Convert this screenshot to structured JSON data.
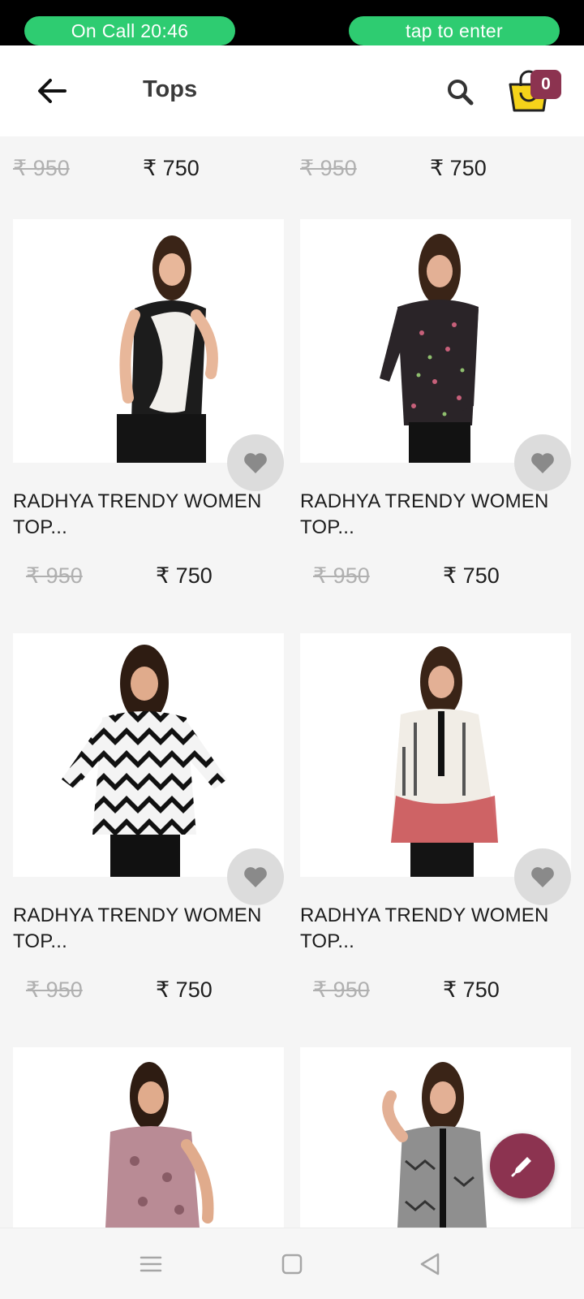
{
  "call_bar": {
    "status_text": "On Call   20:46",
    "action_text": "tap to enter",
    "pill_color": "#2ecc71"
  },
  "app_bar": {
    "title": "Tops",
    "back_icon": "arrow-left-icon",
    "search_icon": "search-icon",
    "cart_icon": "shopping-bag-icon",
    "cart_count": "0",
    "accent_color": "#8c3350",
    "cart_color": "#f5d31a"
  },
  "top_partial_row": [
    {
      "old_price": "₹ 950",
      "price": "₹ 750"
    },
    {
      "old_price": "₹ 950",
      "price": "₹ 750"
    }
  ],
  "products": [
    {
      "name": "RADHYA TRENDY WOMEN TOP...",
      "old_price": "₹ 950",
      "price": "₹ 750",
      "image": "woman-black-white-sleeveless-top"
    },
    {
      "name": "RADHYA TRENDY WOMEN TOP...",
      "old_price": "₹ 950",
      "price": "₹ 750",
      "image": "woman-dark-floral-top"
    },
    {
      "name": "RADHYA TRENDY WOMEN TOP...",
      "old_price": "₹ 950",
      "price": "₹ 750",
      "image": "woman-chevron-bell-sleeve-top"
    },
    {
      "name": "RADHYA TRENDY WOMEN TOP...",
      "old_price": "₹ 950",
      "price": "₹ 750",
      "image": "woman-white-red-print-tunic"
    },
    {
      "name": "",
      "old_price": "",
      "price": "",
      "image": "woman-pink-print-top"
    },
    {
      "name": "",
      "old_price": "",
      "price": "",
      "image": "woman-grey-print-shirt"
    }
  ],
  "fab": {
    "icon": "edit-pen-icon"
  },
  "nav_bar": {
    "menu_icon": "menu-icon",
    "home_icon": "home-square-icon",
    "back_icon": "back-triangle-icon"
  }
}
